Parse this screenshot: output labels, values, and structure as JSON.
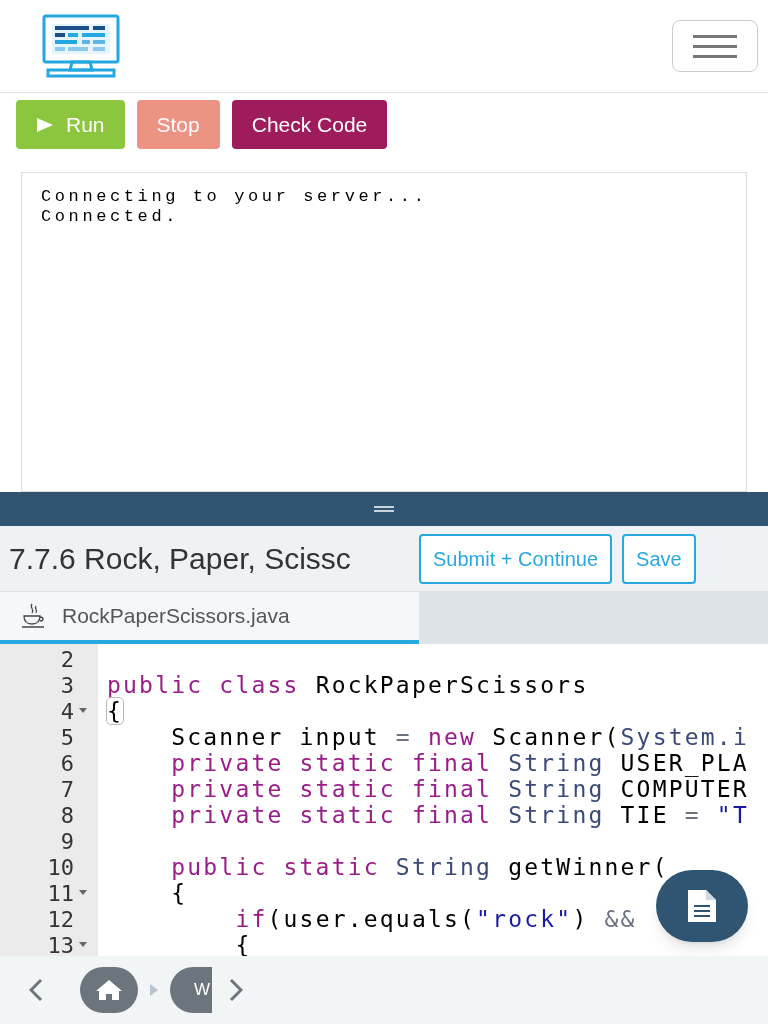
{
  "toolbar": {
    "buttons": [
      {
        "kind": "run",
        "label": "Run"
      },
      {
        "kind": "stop",
        "label": "Stop"
      },
      {
        "kind": "check",
        "label": "Check Code"
      }
    ]
  },
  "console": {
    "lines": [
      "Connecting to your server...",
      "Connected."
    ]
  },
  "exercise": {
    "title": "7.7.6 Rock, Paper, Scissc",
    "buttons": [
      "Submit + Continue",
      "Save"
    ]
  },
  "tabs": [
    {
      "label": "RockPaperScissors.java",
      "selected": true
    }
  ],
  "editor": {
    "lines": [
      {
        "number": "2",
        "foldable": false
      },
      {
        "number": "3",
        "foldable": false,
        "tokens": [
          {
            "kind": "keyword",
            "text": "public class"
          },
          {
            "kind": "plain",
            "text": " RockPaperScissors"
          }
        ]
      },
      {
        "number": "4",
        "foldable": true,
        "tokens": [
          {
            "kind": "brace",
            "text": "{"
          }
        ]
      },
      {
        "number": "5",
        "foldable": false,
        "tokens": [
          {
            "kind": "plain",
            "text": "    Scanner input "
          },
          {
            "kind": "operator",
            "text": "="
          },
          {
            "kind": "keyword",
            "text": " new"
          },
          {
            "kind": "plain",
            "text": " Scanner("
          },
          {
            "kind": "type",
            "text": "System.i"
          }
        ]
      },
      {
        "number": "6",
        "foldable": false,
        "tokens": [
          {
            "kind": "keyword",
            "text": "    private static final"
          },
          {
            "kind": "type",
            "text": " String"
          },
          {
            "kind": "plain",
            "text": " USER_PLA"
          }
        ]
      },
      {
        "number": "7",
        "foldable": false,
        "tokens": [
          {
            "kind": "keyword",
            "text": "    private static final"
          },
          {
            "kind": "type",
            "text": " String"
          },
          {
            "kind": "plain",
            "text": " COMPUTER"
          }
        ]
      },
      {
        "number": "8",
        "foldable": false,
        "tokens": [
          {
            "kind": "keyword",
            "text": "    private static final"
          },
          {
            "kind": "type",
            "text": " String"
          },
          {
            "kind": "plain",
            "text": " TIE "
          },
          {
            "kind": "operator",
            "text": "="
          },
          {
            "kind": "string",
            "text": " \"T"
          }
        ]
      },
      {
        "number": "9",
        "foldable": false
      },
      {
        "number": "10",
        "foldable": false,
        "tokens": [
          {
            "kind": "keyword",
            "text": "    public static"
          },
          {
            "kind": "type",
            "text": " String"
          },
          {
            "kind": "plain",
            "text": " getWinner("
          }
        ]
      },
      {
        "number": "11",
        "foldable": true,
        "tokens": [
          {
            "kind": "plain",
            "text": "    {"
          }
        ]
      },
      {
        "number": "12",
        "foldable": false,
        "tokens": [
          {
            "kind": "keyword",
            "text": "        if"
          },
          {
            "kind": "plain",
            "text": "(user.equals("
          },
          {
            "kind": "string",
            "text": "\"rock\""
          },
          {
            "kind": "plain",
            "text": ") "
          },
          {
            "kind": "operator",
            "text": "&&"
          }
        ]
      },
      {
        "number": "13",
        "foldable": true,
        "tokens": [
          {
            "kind": "plain",
            "text": "        {"
          }
        ]
      }
    ]
  },
  "nav": {
    "items": [
      {
        "kind": "home"
      },
      {
        "kind": "text",
        "label": "W"
      }
    ]
  }
}
